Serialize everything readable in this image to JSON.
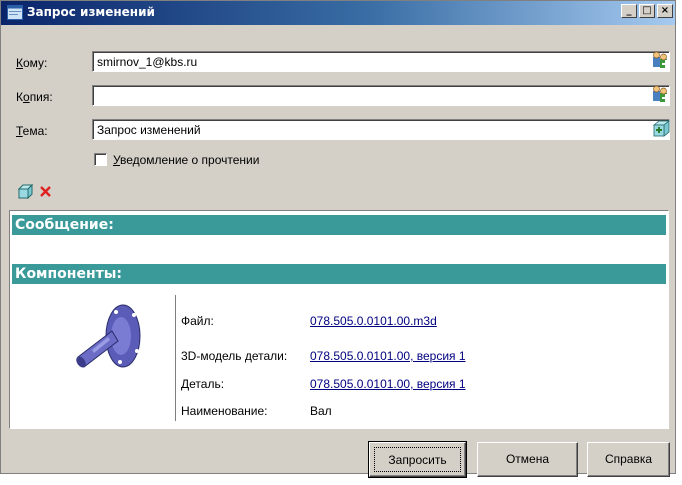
{
  "window": {
    "title": "Запрос изменений",
    "controls": {
      "minimize": "_",
      "maximize": "□",
      "close": "×"
    }
  },
  "form": {
    "to": {
      "label_accel": "К",
      "label_rest": "ому:",
      "value": "smirnov_1@kbs.ru"
    },
    "copy": {
      "label_pre": "К",
      "label_accel": "о",
      "label_rest": "пия:",
      "value": ""
    },
    "subject": {
      "label_accel": "Т",
      "label_rest": "ема:",
      "value": "Запрос изменений"
    },
    "read_receipt": {
      "label_accel": "У",
      "label_rest": "ведомление о прочтении",
      "checked": false
    }
  },
  "content": {
    "message_header": "Сообщение:",
    "components_header": "Компоненты:",
    "file_label": "Файл:",
    "file_link": "078.505.0.0101.00.m3d",
    "model_label": "3D-модель детали:",
    "model_link": "078.505.0.0101.00, версия 1",
    "part_label": "Деталь:",
    "part_link": "078.505.0.0101.00, версия 1",
    "name_label": "Наименование:",
    "name_value": "Вал"
  },
  "buttons": {
    "request": "Запросить",
    "cancel": "Отмена",
    "help": "Справка"
  },
  "icons": [
    "window-icon",
    "address-book-icon",
    "cube-add-icon",
    "cube-icon",
    "delete-x-icon",
    "shaft-part-thumbnail"
  ],
  "colors": {
    "section_bar": "#3a9a9a",
    "link": "#000080",
    "delete": "#e02020"
  }
}
